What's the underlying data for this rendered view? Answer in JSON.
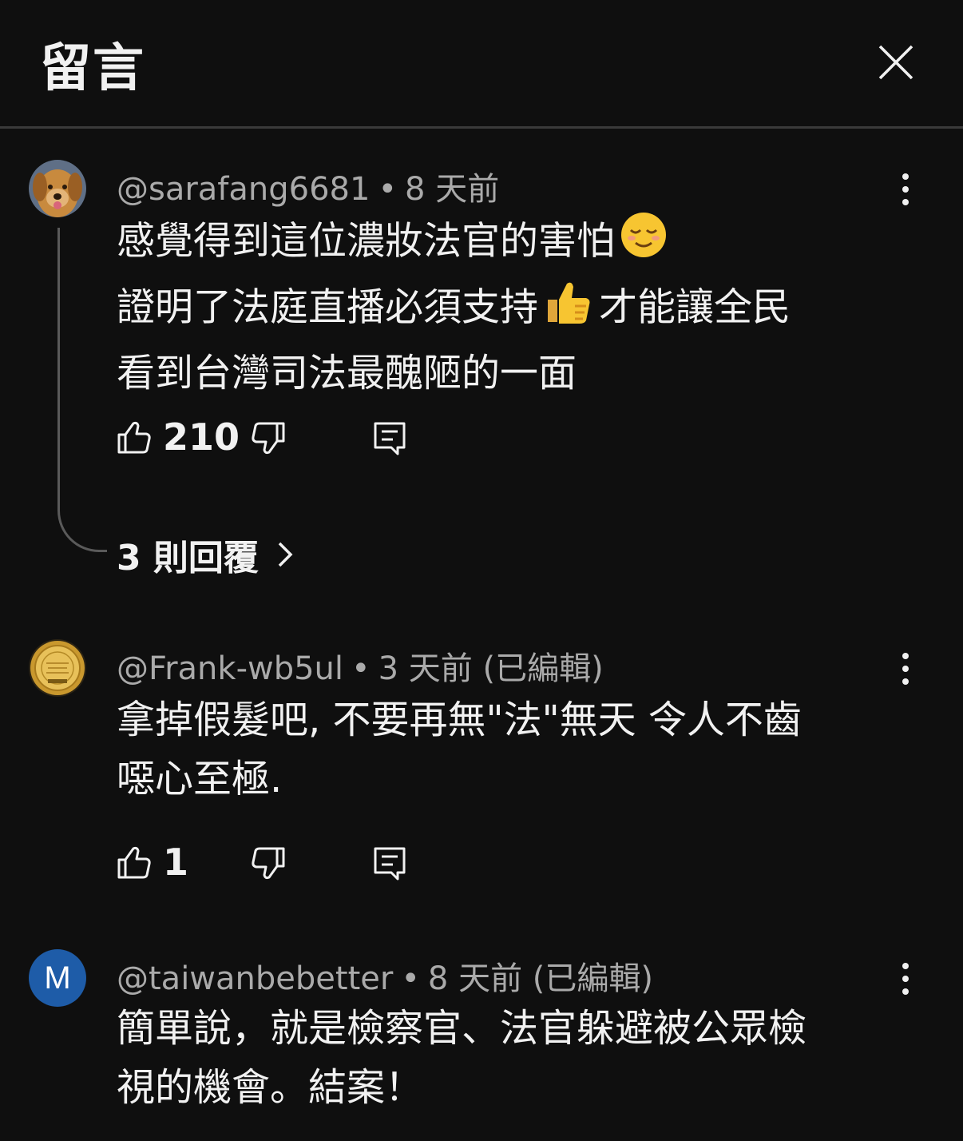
{
  "header": {
    "title": "留言"
  },
  "comments": [
    {
      "author": "@sarafang6681",
      "separator": "•",
      "time": "8 天前",
      "edited": "",
      "lines": [
        "感覺得到這位濃妝法官的害怕",
        "證明了法庭直播必須支持",
        "才能讓全民",
        "看到台灣司法最醜陋的一面"
      ],
      "likes": "210",
      "replies": "3 則回覆"
    },
    {
      "author": "@Frank-wb5ul",
      "separator": "•",
      "time": "3 天前",
      "edited": "(已編輯)",
      "lines": [
        "拿掉假髮吧, 不要再無\"法\"無天 令人不齒",
        "噁心至極."
      ],
      "likes": "1"
    },
    {
      "author": "@taiwanbebetter",
      "separator": "•",
      "time": "8 天前",
      "edited": "(已編輯)",
      "avatar_letter": "M",
      "lines": [
        "簡單說，就是檢察官、法官躲避被公眾檢",
        "視的機會。結案！"
      ]
    }
  ],
  "colors": {
    "background": "#0f0f0f",
    "text": "#f1f1f1",
    "meta": "#aaaaaa",
    "avatar_blue": "#1e5ca8"
  },
  "icons": [
    "close-icon",
    "more-vertical-icon",
    "thumbs-up-icon",
    "thumbs-down-icon",
    "reply-icon",
    "chevron-right-icon",
    "relieved-face-emoji",
    "thumbs-up-emoji"
  ]
}
